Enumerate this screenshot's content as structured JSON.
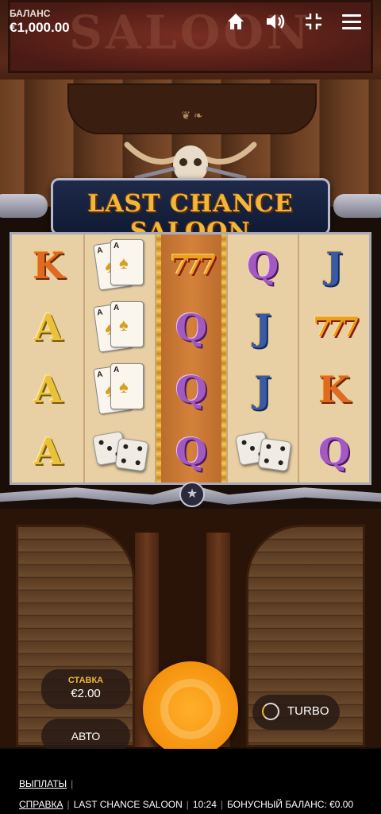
{
  "hud": {
    "balance_label": "БАЛАНС",
    "balance_value": "€1,000.00",
    "icons": [
      "home-icon",
      "volume-icon",
      "collapse-icon",
      "menu-icon"
    ]
  },
  "sign": {
    "text": "SALOON"
  },
  "game": {
    "title": "LAST CHANCE SALOON",
    "reels": [
      [
        "K",
        "A",
        "A",
        "A"
      ],
      [
        "ACES",
        "ACES",
        "ACES",
        "DICE"
      ],
      [
        "777",
        "Q",
        "Q",
        "Q"
      ],
      [
        "Q",
        "J",
        "J",
        "DICE"
      ],
      [
        "J",
        "777",
        "K",
        "Q"
      ]
    ],
    "highlighted_reel": 3
  },
  "controls": {
    "bet_label": "СТАВКА",
    "bet_value": "€2.00",
    "auto_label": "АВТО",
    "turbo_label": "TURBO"
  },
  "footer": {
    "payouts_link": "ВЫПЛАТЫ",
    "help_link": "СПРАВКА",
    "game_name": "LAST CHANCE SALOON",
    "time": "10:24",
    "bonus_balance": "БОНУСНЫЙ БАЛАНС: €0.00"
  },
  "colors": {
    "accent_gold": "#f2b638",
    "spin_orange": "#f5920e",
    "reel_bg": "#e9cfa4"
  }
}
